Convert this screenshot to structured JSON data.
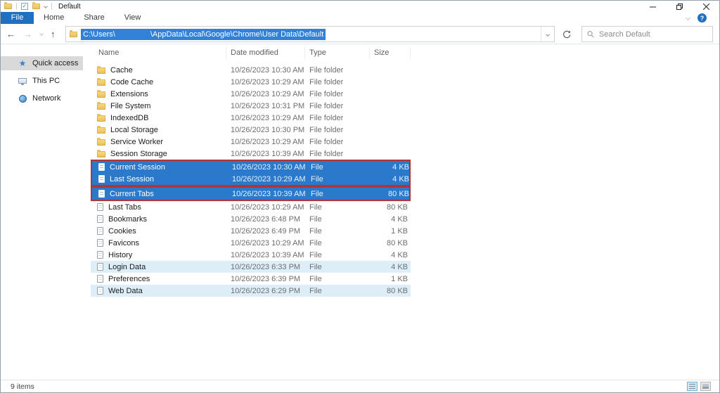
{
  "window": {
    "title": "Default"
  },
  "ribbon": {
    "tabs": [
      {
        "label": "File",
        "active": true
      },
      {
        "label": "Home",
        "active": false
      },
      {
        "label": "Share",
        "active": false
      },
      {
        "label": "View",
        "active": false
      }
    ],
    "help_label": "?"
  },
  "navigation": {
    "back_glyph": "←",
    "forward_glyph": "→",
    "up_glyph": "↑"
  },
  "address": {
    "path_prefix": "C:\\Users\\",
    "path_suffix": "\\AppData\\Local\\Google\\Chrome\\User Data\\Default"
  },
  "search": {
    "placeholder": "Search Default"
  },
  "sidebar": {
    "items": [
      {
        "label": "Quick access",
        "icon": "star-icon",
        "selected": true
      },
      {
        "label": "This PC",
        "icon": "monitor-icon",
        "selected": false
      },
      {
        "label": "Network",
        "icon": "globe-icon",
        "selected": false
      }
    ]
  },
  "table": {
    "columns": [
      "Name",
      "Date modified",
      "Type",
      "Size"
    ],
    "rows": [
      {
        "name": "Cache",
        "date": "10/26/2023 10:30 AM",
        "type": "File folder",
        "size": "",
        "kind": "folder",
        "state": "normal",
        "box": null
      },
      {
        "name": "Code Cache",
        "date": "10/26/2023 10:29 AM",
        "type": "File folder",
        "size": "",
        "kind": "folder",
        "state": "normal",
        "box": null
      },
      {
        "name": "Extensions",
        "date": "10/26/2023 10:29 AM",
        "type": "File folder",
        "size": "",
        "kind": "folder",
        "state": "normal",
        "box": null
      },
      {
        "name": "File System",
        "date": "10/26/2023 10:31 PM",
        "type": "File folder",
        "size": "",
        "kind": "folder",
        "state": "normal",
        "box": null
      },
      {
        "name": "IndexedDB",
        "date": "10/26/2023 10:29 AM",
        "type": "File folder",
        "size": "",
        "kind": "folder",
        "state": "normal",
        "box": null
      },
      {
        "name": "Local Storage",
        "date": "10/26/2023 10:30 PM",
        "type": "File folder",
        "size": "",
        "kind": "folder",
        "state": "normal",
        "box": null
      },
      {
        "name": "Service Worker",
        "date": "10/26/2023 10:29 AM",
        "type": "File folder",
        "size": "",
        "kind": "folder",
        "state": "normal",
        "box": null
      },
      {
        "name": "Session Storage",
        "date": "10/26/2023 10:39 AM",
        "type": "File folder",
        "size": "",
        "kind": "folder",
        "state": "normal",
        "box": null
      },
      {
        "name": "Current Session",
        "date": "10/26/2023 10:30 AM",
        "type": "File",
        "size": "4 KB",
        "kind": "file",
        "state": "selected",
        "box": "a"
      },
      {
        "name": "Last Session",
        "date": "10/26/2023 10:29 AM",
        "type": "File",
        "size": "4 KB",
        "kind": "file",
        "state": "selected",
        "box": "a"
      },
      {
        "name": "Current Tabs",
        "date": "10/26/2023 10:39 AM",
        "type": "File",
        "size": "80 KB",
        "kind": "file",
        "state": "selected",
        "box": "b"
      },
      {
        "name": "Last Tabs",
        "date": "10/26/2023 10:29 AM",
        "type": "File",
        "size": "80 KB",
        "kind": "file",
        "state": "normal",
        "box": null
      },
      {
        "name": "Bookmarks",
        "date": "10/26/2023 6:48 PM",
        "type": "File",
        "size": "4 KB",
        "kind": "file",
        "state": "normal",
        "box": null
      },
      {
        "name": "Cookies",
        "date": "10/26/2023 6:49 PM",
        "type": "File",
        "size": "1 KB",
        "kind": "file",
        "state": "normal",
        "box": null
      },
      {
        "name": "Favicons",
        "date": "10/26/2023 10:29 AM",
        "type": "File",
        "size": "80 KB",
        "kind": "file",
        "state": "normal",
        "box": null
      },
      {
        "name": "History",
        "date": "10/26/2023 10:39 AM",
        "type": "File",
        "size": "4 KB",
        "kind": "file",
        "state": "normal",
        "box": null
      },
      {
        "name": "Login Data",
        "date": "10/26/2023 6:33 PM",
        "type": "File",
        "size": "4 KB",
        "kind": "file",
        "state": "tinted",
        "box": null
      },
      {
        "name": "Preferences",
        "date": "10/26/2023 6:39 PM",
        "type": "File",
        "size": "1 KB",
        "kind": "file",
        "state": "normal",
        "box": null
      },
      {
        "name": "Web Data",
        "date": "10/26/2023 6:29 PM",
        "type": "File",
        "size": "80 KB",
        "kind": "file",
        "state": "tinted",
        "box": null
      }
    ]
  },
  "status": {
    "items_text": "9 items"
  },
  "colors": {
    "accent_blue": "#1f70c1",
    "selection_blue": "#2a79cb",
    "address_selection_blue": "#3181d8",
    "annotation_red": "#b23434",
    "row_tint_blue": "#ddeef9",
    "quick_access_highlight": "#d9d9d9"
  }
}
